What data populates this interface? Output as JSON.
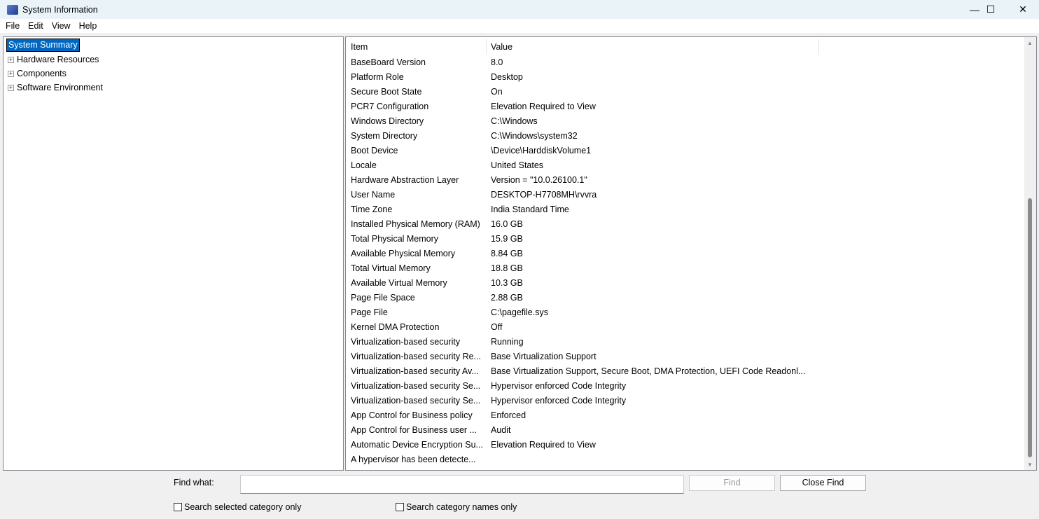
{
  "window": {
    "title": "System Information"
  },
  "menu": [
    "File",
    "Edit",
    "View",
    "Help"
  ],
  "tree": {
    "selected": "System Summary",
    "children": [
      "Hardware Resources",
      "Components",
      "Software Environment"
    ]
  },
  "list": {
    "columns": [
      "Item",
      "Value"
    ],
    "rows": [
      [
        "BaseBoard Version",
        "8.0"
      ],
      [
        "Platform Role",
        "Desktop"
      ],
      [
        "Secure Boot State",
        "On"
      ],
      [
        "PCR7 Configuration",
        "Elevation Required to View"
      ],
      [
        "Windows Directory",
        "C:\\Windows"
      ],
      [
        "System Directory",
        "C:\\Windows\\system32"
      ],
      [
        "Boot Device",
        "\\Device\\HarddiskVolume1"
      ],
      [
        "Locale",
        "United States"
      ],
      [
        "Hardware Abstraction Layer",
        "Version = \"10.0.26100.1\""
      ],
      [
        "User Name",
        "DESKTOP-H7708MH\\rvvra"
      ],
      [
        "Time Zone",
        "India Standard Time"
      ],
      [
        "Installed Physical Memory (RAM)",
        "16.0 GB"
      ],
      [
        "Total Physical Memory",
        "15.9 GB"
      ],
      [
        "Available Physical Memory",
        "8.84 GB"
      ],
      [
        "Total Virtual Memory",
        "18.8 GB"
      ],
      [
        "Available Virtual Memory",
        "10.3 GB"
      ],
      [
        "Page File Space",
        "2.88 GB"
      ],
      [
        "Page File",
        "C:\\pagefile.sys"
      ],
      [
        "Kernel DMA Protection",
        "Off"
      ],
      [
        "Virtualization-based security",
        "Running"
      ],
      [
        "Virtualization-based security Re...",
        "Base Virtualization Support"
      ],
      [
        "Virtualization-based security Av...",
        "Base Virtualization Support, Secure Boot, DMA Protection, UEFI Code Readonl..."
      ],
      [
        "Virtualization-based security Se...",
        "Hypervisor enforced Code Integrity"
      ],
      [
        "Virtualization-based security Se...",
        "Hypervisor enforced Code Integrity"
      ],
      [
        "App Control for Business policy",
        "Enforced"
      ],
      [
        "App Control for Business user ...",
        "Audit"
      ],
      [
        "Automatic Device Encryption Su...",
        "Elevation Required to View"
      ],
      [
        "A hypervisor has been detecte...",
        ""
      ]
    ]
  },
  "find": {
    "label": "Find what:",
    "value": "",
    "find_button": "Find",
    "close_button": "Close Find",
    "check1": "Search selected category only",
    "check2": "Search category names only"
  }
}
